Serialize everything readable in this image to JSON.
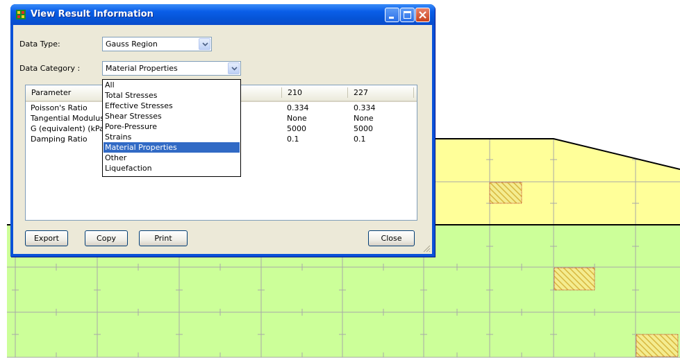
{
  "window": {
    "title": "View Result Information",
    "accent": "#0a52d8"
  },
  "data_type": {
    "label": "Data Type:",
    "value": "Gauss Region"
  },
  "data_category": {
    "label": "Data Category :",
    "value": "Material Properties",
    "options": [
      "All",
      "Total Stresses",
      "Effective Stresses",
      "Shear Stresses",
      "Pore-Pressure",
      "Strains",
      "Material Properties",
      "Other",
      "Liquefaction"
    ],
    "selected_index": 6
  },
  "table": {
    "columns": [
      "Parameter",
      "210",
      "227"
    ],
    "rows": [
      {
        "parameter": "Poisson's Ratio",
        "c210": "0.334",
        "c227": "0.334"
      },
      {
        "parameter": "Tangential Modulus",
        "c210": "None",
        "c227": "None"
      },
      {
        "parameter": "G (equivalent) (kPa)",
        "c210": "5000",
        "c227": "5000"
      },
      {
        "parameter": "Damping Ratio",
        "c210": "0.1",
        "c227": "0.1"
      }
    ]
  },
  "buttons": {
    "export": "Export",
    "copy": "Copy",
    "print": "Print",
    "close": "Close"
  },
  "background": {
    "upper_region_color": "#ffff99",
    "lower_region_color": "#ccff99",
    "grid_color": "#a8a8a8",
    "selected_element_color": "#e0c040"
  }
}
